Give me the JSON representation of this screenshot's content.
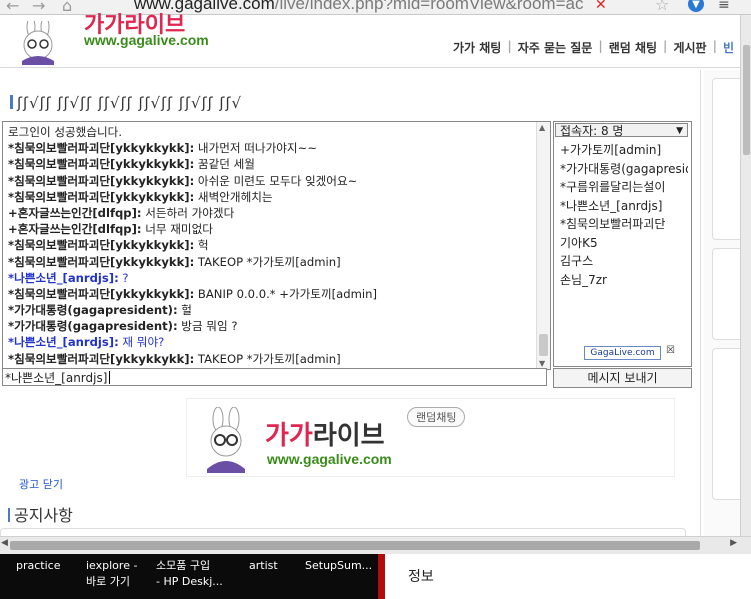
{
  "browser": {
    "url_host": "www.gagalive.com",
    "url_path": "/live/index.php?mid=roomView&room=ac"
  },
  "site": {
    "brand": "가가라이브",
    "url_text": "www.gagalive.com",
    "nav": [
      "가가 채팅",
      "자주 묻는 질문",
      "랜덤 채팅",
      "게시판",
      "빈"
    ]
  },
  "panel": {
    "title": "ʃʃ√ʃʃ ʃʃ√ʃʃ ʃʃ√ʃʃ ʃʃ√ʃʃ ʃʃ√ʃʃ ʃʃ√"
  },
  "chat": {
    "lines": [
      {
        "nick": "",
        "text": "로그인이 성공했습니다.",
        "style": "system"
      },
      {
        "nick": "*침묵의보빨러파괴단[ykkykkykk]:",
        "text": " 내가먼저 떠나가야지~~",
        "style": "normal"
      },
      {
        "nick": "*침묵의보빨러파괴단[ykkykkykk]:",
        "text": " 꿈같던 세월",
        "style": "normal"
      },
      {
        "nick": "*침묵의보빨러파괴단[ykkykkykk]:",
        "text": " 아쉬운 미련도 모두다 잊겠어요~",
        "style": "normal"
      },
      {
        "nick": "*침묵의보빨러파괴단[ykkykkykk]:",
        "text": " 새벽안개헤치는",
        "style": "normal"
      },
      {
        "nick": "+혼자글쓰는인간[dlfqp]:",
        "text": " 서든하러 가야겠다",
        "style": "normal"
      },
      {
        "nick": "+혼자글쓰는인간[dlfqp]:",
        "text": " 너무 재미없다",
        "style": "normal"
      },
      {
        "nick": "*침묵의보빨러파괴단[ykkykkykk]:",
        "text": " 헉",
        "style": "normal"
      },
      {
        "nick": "*침묵의보빨러파괴단[ykkykkykk]:",
        "text": " TAKEOP *가가토끼[admin]",
        "style": "normal"
      },
      {
        "nick": "*나쁜소년_[anrdjs]:",
        "text": " ?",
        "style": "blue"
      },
      {
        "nick": "*침묵의보빨러파괴단[ykkykkykk]:",
        "text": " BANIP 0.0.0.* +가가토끼[admin]",
        "style": "normal"
      },
      {
        "nick": "*가가대통령(gagapresident):",
        "text": " 헐",
        "style": "normal"
      },
      {
        "nick": "*가가대통령(gagapresident):",
        "text": " 방금 뭐임 ?",
        "style": "normal"
      },
      {
        "nick": "*나쁜소년_[anrdjs]:",
        "text": " 재 뭐야?",
        "style": "blue"
      },
      {
        "nick": "*침묵의보빨러파괴단[ykkykkykk]:",
        "text": " TAKEOP *가가토끼[admin]",
        "style": "normal"
      }
    ],
    "input_value": "*나쁜소년_[anrdjs]"
  },
  "users": {
    "count_label": "접속자: 8 명",
    "list": [
      "+가가토끼[admin]",
      "*가가대통령(gagapresident)",
      "*구름위를달리는설이",
      "*나쁜소년_[anrdjs]",
      "*침묵의보빨러파괴단",
      "기아K5",
      "김구스",
      "손님_7zr"
    ],
    "mini_ad": "GagaLive.com",
    "send_label": "메시지 보내기"
  },
  "banner": {
    "brand_part1": "가가",
    "brand_part2": "라이브",
    "url_text": "www.gagalive.com",
    "tag": "랜덤채팅"
  },
  "ad_close": "광고 닫기",
  "notice_title": "공지사항",
  "taskbar": {
    "items": [
      {
        "line1": "practice",
        "line2": ""
      },
      {
        "line1": "iexplore -",
        "line2": "바로 가기"
      },
      {
        "line1": "소모품 구입",
        "line2": "- HP Deskj..."
      },
      {
        "line1": "artist",
        "line2": ""
      },
      {
        "line1": "SetupSum...",
        "line2": ""
      }
    ]
  },
  "right_pane_label": "정보",
  "colors": {
    "brand_pink": "#e0254e",
    "brand_green": "#3a8c1a",
    "nick_blue": "#2233cc"
  }
}
